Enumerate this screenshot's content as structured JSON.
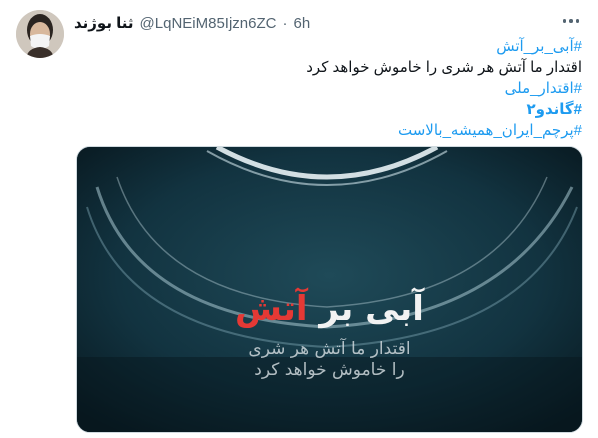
{
  "tweet": {
    "author_name": "ثنا بوژند",
    "handle": "@LqNEiM85Ijzn6ZC",
    "separator": "·",
    "time": "6h",
    "lines": [
      {
        "text": "#آبی_بر_آتش",
        "kind": "hashtag"
      },
      {
        "text": "اقتدار ما آتش هر شری را خاموش خواهد کرد",
        "kind": "text"
      },
      {
        "text": "#اقتدار_ملی",
        "kind": "hashtag"
      },
      {
        "text": "#گاندو۲",
        "kind": "hashtag-bold"
      },
      {
        "text": "#پرچم_ایران_همیشه_بالاست",
        "kind": "hashtag"
      }
    ],
    "media": {
      "title_white": "آبی بر",
      "title_red": "آتش",
      "subtitle_line1": "اقتدار ما آتش هر شری",
      "subtitle_line2": "را خاموش خواهد کرد"
    }
  },
  "icons": {
    "avatar": "masked-person-avatar",
    "more": "more-options-icon"
  },
  "colors": {
    "link": "#1d9bf0",
    "text": "#0f1419",
    "secondary": "#536471",
    "poster_red": "#e53935"
  }
}
